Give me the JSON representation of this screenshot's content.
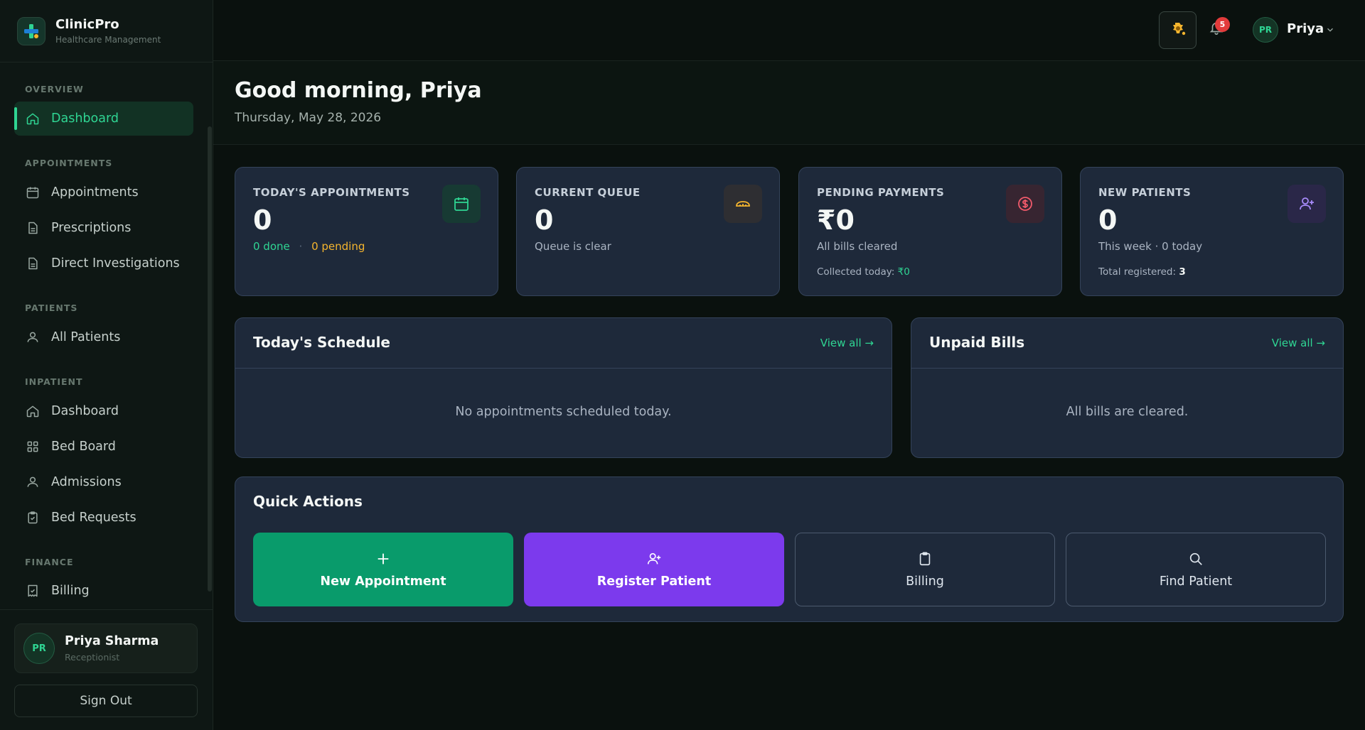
{
  "app": {
    "name": "ClinicPro",
    "tagline": "Healthcare Management"
  },
  "sidebar": {
    "sections": {
      "overview": "OVERVIEW",
      "appointments": "APPOINTMENTS",
      "patients": "PATIENTS",
      "inpatient": "INPATIENT",
      "finance": "FINANCE"
    },
    "items": [
      {
        "label": "Dashboard",
        "icon": "home-icon",
        "active": true
      },
      {
        "label": "Appointments",
        "icon": "calendar-icon"
      },
      {
        "label": "Prescriptions",
        "icon": "document-icon"
      },
      {
        "label": "Direct Investigations",
        "icon": "document-icon"
      },
      {
        "label": "All Patients",
        "icon": "users-icon"
      },
      {
        "label": "Dashboard",
        "icon": "home-icon"
      },
      {
        "label": "Bed Board",
        "icon": "grid-icon"
      },
      {
        "label": "Admissions",
        "icon": "users-icon"
      },
      {
        "label": "Bed Requests",
        "icon": "clipboard-check-icon"
      },
      {
        "label": "Billing",
        "icon": "receipt-icon"
      }
    ],
    "user": {
      "initials": "PR",
      "name": "Priya Sharma",
      "role": "Receptionist"
    },
    "sign_out": "Sign Out"
  },
  "topbar": {
    "notification_count": "5",
    "user_initials": "PR",
    "user_name": "Priya"
  },
  "greeting": {
    "title": "Good morning, Priya",
    "date": "Thursday, May 28, 2026"
  },
  "stats": {
    "appointments": {
      "label": "TODAY'S APPOINTMENTS",
      "value": "0",
      "done": "0 done",
      "sep": "·",
      "pending": "0 pending"
    },
    "queue": {
      "label": "CURRENT QUEUE",
      "value": "0",
      "sub": "Queue is clear"
    },
    "payments": {
      "label": "PENDING PAYMENTS",
      "value": "₹0",
      "sub": "All bills cleared",
      "foot_label": "Collected today: ",
      "foot_value": "₹0"
    },
    "patients": {
      "label": "NEW PATIENTS",
      "value": "0",
      "sub": "This week · 0 today",
      "foot_label": "Total registered: ",
      "foot_value": "3"
    }
  },
  "schedule": {
    "title": "Today's Schedule",
    "link": "View all →",
    "empty": "No appointments scheduled today."
  },
  "bills": {
    "title": "Unpaid Bills",
    "link": "View all →",
    "empty": "All bills are cleared."
  },
  "quick_actions": {
    "title": "Quick Actions",
    "new_appointment": "New Appointment",
    "register_patient": "Register Patient",
    "billing": "Billing",
    "find_patient": "Find Patient"
  },
  "colors": {
    "accent_green": "#2fd593",
    "button_green": "#099b6b",
    "button_purple": "#7c3aed",
    "warning_amber": "#f5b52e",
    "danger_red": "#e23b3b",
    "card_bg": "#1e293a"
  }
}
